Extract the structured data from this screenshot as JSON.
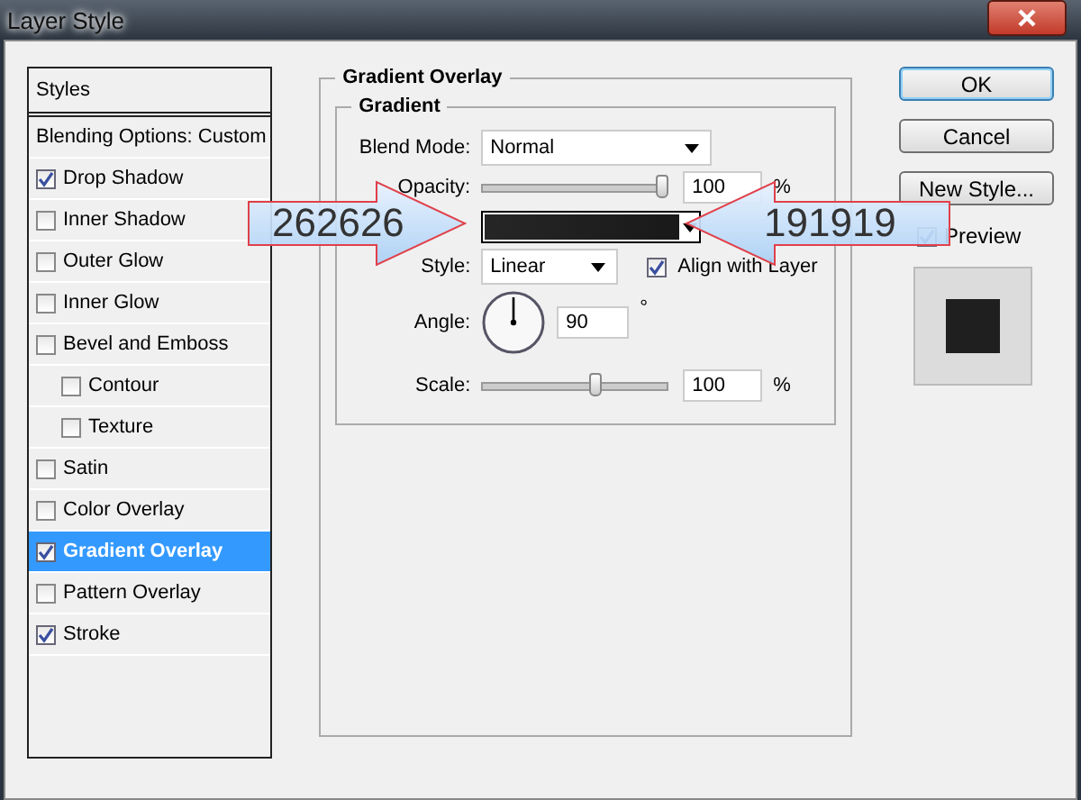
{
  "window": {
    "title": "Layer Style"
  },
  "styles_list": {
    "header": "Styles",
    "items": [
      {
        "label": "Blending Options: Custom",
        "kind": "plain",
        "selected": false
      },
      {
        "label": "Drop Shadow",
        "kind": "check",
        "checked": true,
        "selected": false
      },
      {
        "label": "Inner Shadow",
        "kind": "check",
        "checked": false,
        "selected": false
      },
      {
        "label": "Outer Glow",
        "kind": "check",
        "checked": false,
        "selected": false
      },
      {
        "label": "Inner Glow",
        "kind": "check",
        "checked": false,
        "selected": false
      },
      {
        "label": "Bevel and Emboss",
        "kind": "check",
        "checked": false,
        "selected": false,
        "children": [
          {
            "label": "Contour",
            "kind": "check",
            "checked": false,
            "selected": false
          },
          {
            "label": "Texture",
            "kind": "check",
            "checked": false,
            "selected": false
          }
        ]
      },
      {
        "label": "Satin",
        "kind": "check",
        "checked": false,
        "selected": false
      },
      {
        "label": "Color Overlay",
        "kind": "check",
        "checked": false,
        "selected": false
      },
      {
        "label": "Gradient Overlay",
        "kind": "check",
        "checked": true,
        "selected": true
      },
      {
        "label": "Pattern Overlay",
        "kind": "check",
        "checked": false,
        "selected": false
      },
      {
        "label": "Stroke",
        "kind": "check",
        "checked": true,
        "selected": false
      }
    ]
  },
  "panel": {
    "title": "Gradient Overlay",
    "group_title": "Gradient",
    "blend_mode": {
      "label": "Blend Mode:",
      "value": "Normal"
    },
    "opacity": {
      "label": "Opacity:",
      "level": 1.0,
      "value": "100",
      "unit": "%"
    },
    "style": {
      "label": "Style:",
      "value": "Linear",
      "align_label": "Align with Layer",
      "align_checked": true
    },
    "angle": {
      "label": "Angle:",
      "value": "90",
      "unit": "°"
    },
    "scale": {
      "label": "Scale:",
      "level": 0.62,
      "value": "100",
      "unit": "%"
    }
  },
  "buttons": [
    {
      "label": "OK",
      "default": true
    },
    {
      "label": "Cancel",
      "default": false
    },
    {
      "label": "New Style...",
      "default": false
    }
  ],
  "preview": {
    "label": "Preview",
    "checked": true
  },
  "callouts": [
    {
      "text": "262626",
      "kind": "right-arrow"
    },
    {
      "text": "191919",
      "kind": "left-arrow"
    }
  ]
}
